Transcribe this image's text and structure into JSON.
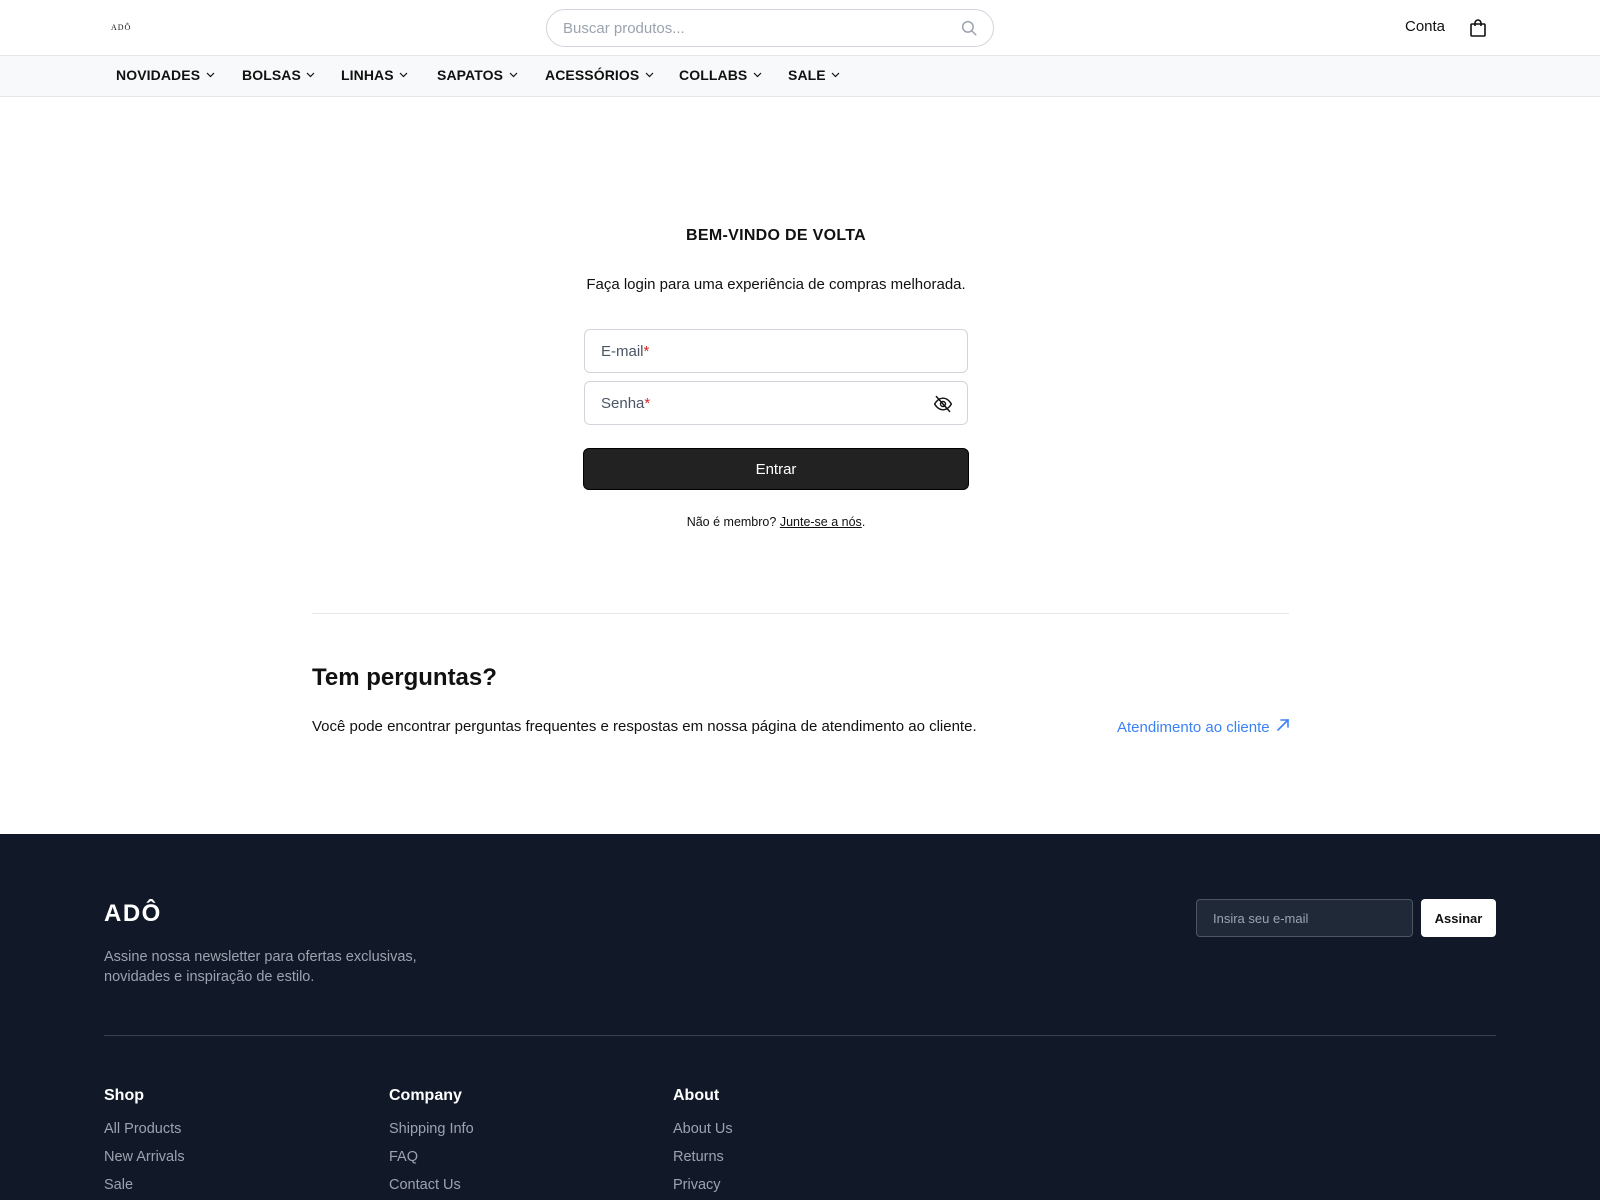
{
  "header": {
    "logo": "ADÔ",
    "search_placeholder": "Buscar produtos...",
    "account_label": "Conta",
    "icons": {
      "search": "search-icon",
      "bag": "shopping-bag-icon"
    }
  },
  "nav": {
    "items": [
      {
        "label": "NOVIDADES"
      },
      {
        "label": "BOLSAS"
      },
      {
        "label": "LINHAS"
      },
      {
        "label": "SAPATOS"
      },
      {
        "label": "ACESSÓRIOS"
      },
      {
        "label": "COLLABS"
      },
      {
        "label": "SALE"
      }
    ]
  },
  "login": {
    "title": "BEM-VINDO DE VOLTA",
    "subtitle": "Faça login para uma experiência de compras melhorada.",
    "email_label": "E-mail",
    "password_label": "Senha",
    "required_mark": "*",
    "submit_label": "Entrar",
    "member_prompt": "Não é membro?",
    "join_link": "Junte-se a nós",
    "member_suffix": "."
  },
  "faq": {
    "title": "Tem perguntas?",
    "text": "Você pode encontrar perguntas frequentes e respostas em nossa página de atendimento ao cliente.",
    "link_label": "Atendimento ao cliente"
  },
  "footer": {
    "brand": "ADÔ",
    "description": "Assine nossa newsletter para ofertas exclusivas, novidades e inspiração de estilo.",
    "email_placeholder": "Insira seu e-mail",
    "subscribe_label": "Assinar",
    "columns": [
      {
        "title": "Shop",
        "links": [
          "All Products",
          "New Arrivals",
          "Sale"
        ]
      },
      {
        "title": "Company",
        "links": [
          "Shipping Info",
          "FAQ",
          "Contact Us"
        ]
      },
      {
        "title": "About",
        "links": [
          "About Us",
          "Returns",
          "Privacy"
        ]
      }
    ]
  },
  "colors": {
    "footer_bg": "#111827",
    "link_blue": "#3b82f6",
    "required_red": "#dc2626",
    "button_dark": "#222222"
  }
}
